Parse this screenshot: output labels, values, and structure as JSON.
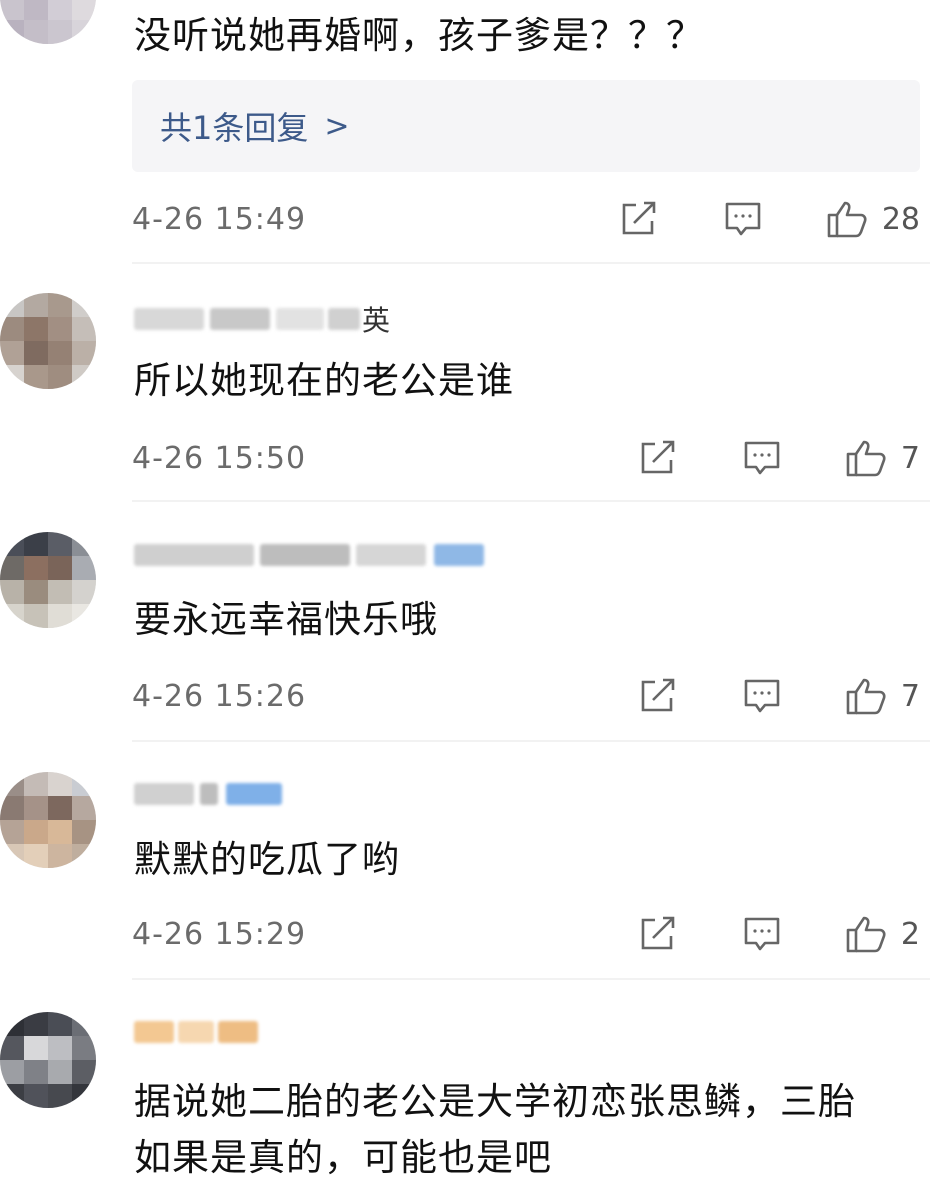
{
  "comments": [
    {
      "username_tail": "",
      "text": "没听说她再婚啊，孩子爹是？？？",
      "reply_label": "共1条回复",
      "reply_chevron": ">",
      "time": "4-26 15:49",
      "likes": "28"
    },
    {
      "username_tail": "英",
      "text": "所以她现在的老公是谁",
      "time": "4-26 15:50",
      "likes": "7"
    },
    {
      "username_tail": "",
      "text": "要永远幸福快乐哦",
      "time": "4-26 15:26",
      "likes": "7"
    },
    {
      "username_tail": "",
      "text": "默默的吃瓜了哟",
      "time": "4-26 15:29",
      "likes": "2"
    },
    {
      "username_tail": "",
      "text_line1": "据说她二胎的老公是大学初恋张思鳞，三胎",
      "text_line2": "如果是真的，可能也是吧"
    }
  ],
  "icons": {
    "share": "share-icon",
    "comment": "comment-icon",
    "like": "thumbs-up-icon"
  },
  "colors": {
    "reply_link": "#3d5a8a",
    "timestamp": "#6b6b6b",
    "reply_box_bg": "#f5f5f7"
  }
}
